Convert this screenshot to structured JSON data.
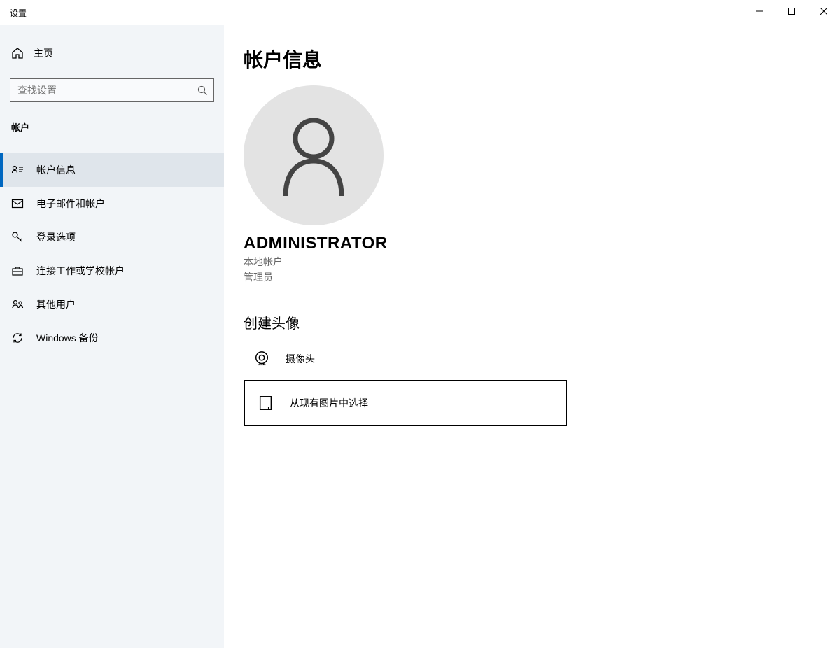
{
  "window": {
    "title": "设置"
  },
  "sidebar": {
    "home": "主页",
    "search_placeholder": "查找设置",
    "category": "帐户",
    "items": [
      {
        "label": "帐户信息"
      },
      {
        "label": "电子邮件和帐户"
      },
      {
        "label": "登录选项"
      },
      {
        "label": "连接工作或学校帐户"
      },
      {
        "label": "其他用户"
      },
      {
        "label": "Windows 备份"
      }
    ]
  },
  "main": {
    "heading": "帐户信息",
    "username": "ADMINISTRATOR",
    "account_type": "本地帐户",
    "role": "管理员",
    "create_avatar_title": "创建头像",
    "camera_label": "摄像头",
    "browse_label": "从现有图片中选择"
  }
}
